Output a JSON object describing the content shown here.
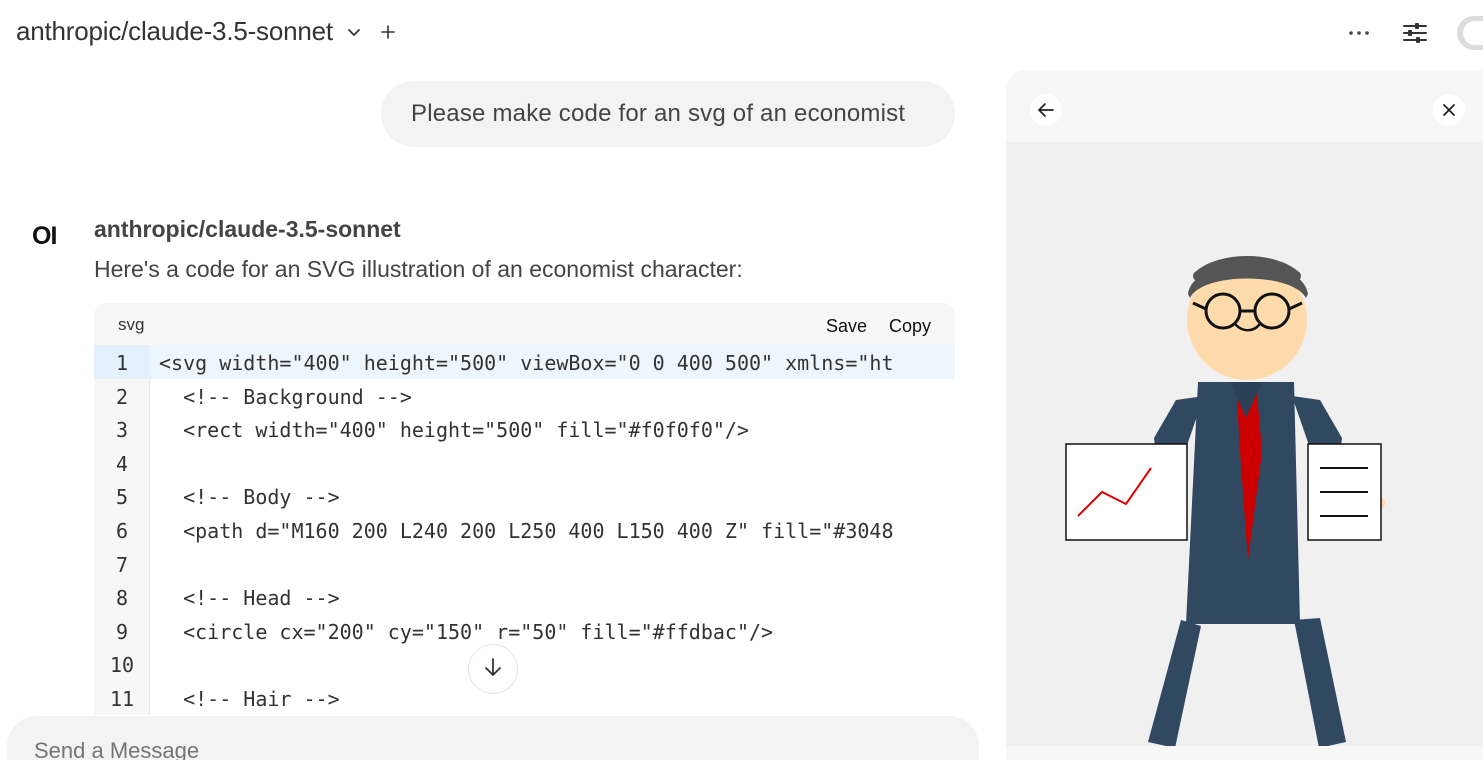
{
  "header": {
    "model_name": "anthropic/claude-3.5-sonnet"
  },
  "chat": {
    "user_message": "Please make code for an svg of an economist",
    "assistant": {
      "logo": "OI",
      "name": "anthropic/claude-3.5-sonnet",
      "intro": "Here's a code for an SVG illustration of an economist character:"
    },
    "code": {
      "language": "svg",
      "save_label": "Save",
      "copy_label": "Copy",
      "lines": [
        {
          "n": "1",
          "text": "<svg width=\"400\" height=\"500\" viewBox=\"0 0 400 500\" xmlns=\"ht"
        },
        {
          "n": "2",
          "text": "  <!-- Background -->"
        },
        {
          "n": "3",
          "text": "  <rect width=\"400\" height=\"500\" fill=\"#f0f0f0\"/>"
        },
        {
          "n": "4",
          "text": ""
        },
        {
          "n": "5",
          "text": "  <!-- Body -->"
        },
        {
          "n": "6",
          "text": "  <path d=\"M160 200 L240 200 L250 400 L150 400 Z\" fill=\"#3048"
        },
        {
          "n": "7",
          "text": ""
        },
        {
          "n": "8",
          "text": "  <!-- Head -->"
        },
        {
          "n": "9",
          "text": "  <circle cx=\"200\" cy=\"150\" r=\"50\" fill=\"#ffdbac\"/>"
        },
        {
          "n": "10",
          "text": ""
        },
        {
          "n": "11",
          "text": "  <!-- Hair -->"
        }
      ]
    }
  },
  "composer": {
    "placeholder": "Send a Message"
  },
  "icons": {
    "chevron": "chevron-down-icon",
    "plus": "plus-icon",
    "more": "more-horizontal-icon",
    "settings": "sliders-icon",
    "back": "arrow-left-icon",
    "close": "close-icon",
    "scroll": "arrow-down-icon"
  },
  "colors": {
    "suit": "#304860",
    "tie": "#cc0000",
    "skin": "#ffdbac",
    "hair": "#555555",
    "background": "#f0f0f0"
  }
}
